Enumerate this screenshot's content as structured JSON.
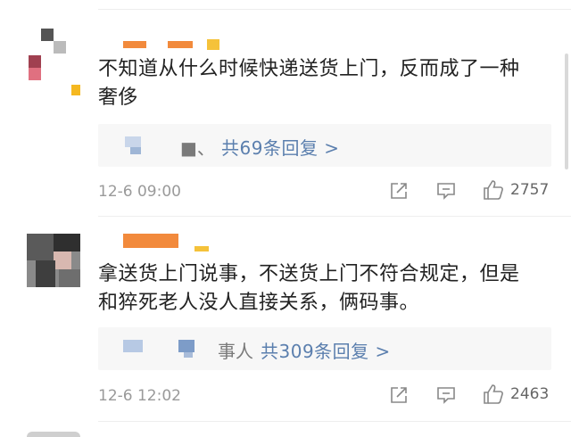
{
  "comments": [
    {
      "text_line1": "不知道从什么时候快递送货上门，反而成了一种",
      "text_line2": "奢侈",
      "reply_prefix": "■、",
      "reply_link": "共69条回复 >",
      "time": "12-6 09:00",
      "likes": "2757"
    },
    {
      "text_line1": "拿送货上门说事，不送货上门不符合规定，但是",
      "text_line2": "和猝死老人没人直接关系，俩码事。",
      "reply_prefix": "事人",
      "reply_link": "共309条回复 >",
      "time": "12-6 12:02",
      "likes": "2463"
    }
  ],
  "colors": {
    "text": "#222222",
    "link": "#5b7fae",
    "meta": "#9a9a9a",
    "reply_bg": "#f7f7f7",
    "name_blur": "#f28a3c"
  },
  "icons": [
    "share-icon",
    "comment-icon",
    "thumbs-up-icon"
  ]
}
